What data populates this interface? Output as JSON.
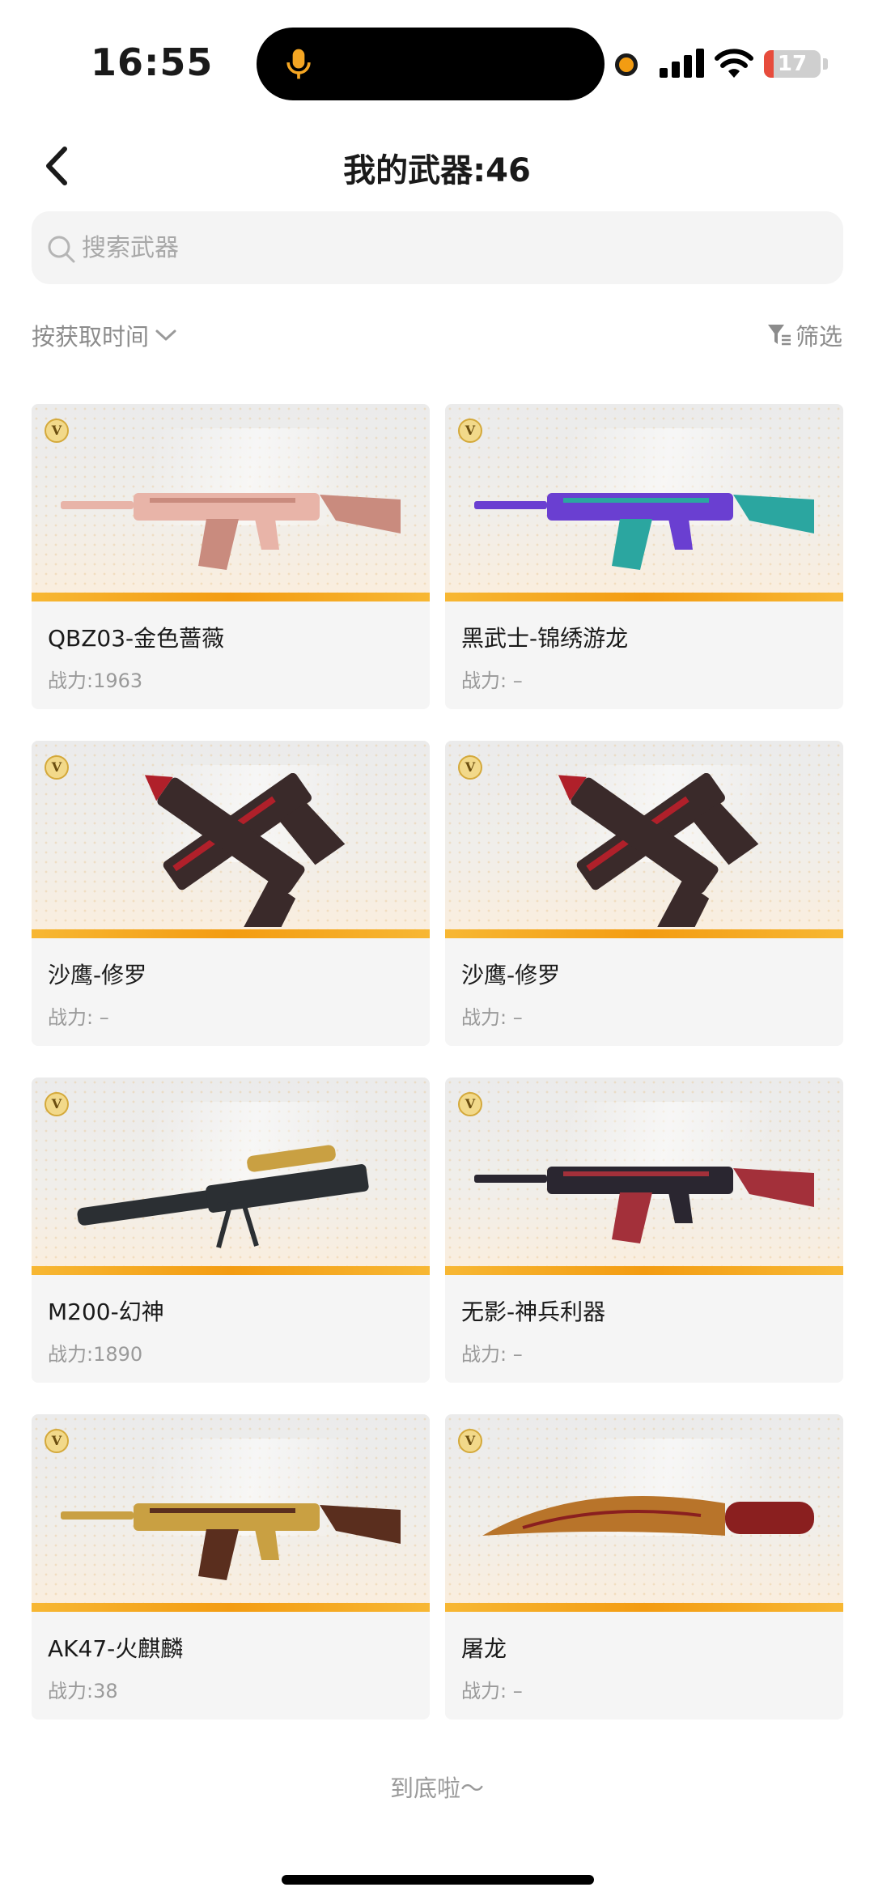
{
  "status_bar": {
    "time": "16:55",
    "battery_level": "17",
    "battery_color": "#e74c3c",
    "recording_dot_color": "#f39c12",
    "icons": [
      "microphone-icon",
      "signal-icon",
      "wifi-icon",
      "battery-icon"
    ]
  },
  "header": {
    "title": "我的武器:46",
    "back_icon": "chevron-left-icon"
  },
  "search": {
    "placeholder": "搜索武器",
    "value": "",
    "icon": "search-icon"
  },
  "toolbar": {
    "sort_label": "按获取时间",
    "sort_icon": "chevron-down-icon",
    "filter_label": "筛选",
    "filter_icon": "funnel-icon"
  },
  "weapons": [
    {
      "name": "QBZ03-金色蔷薇",
      "power": "战力:1963",
      "badge": "V",
      "icon": "rifle-icon",
      "colors": [
        "#e8b4a8",
        "#c98b7e"
      ]
    },
    {
      "name": "黑武士-锦绣游龙",
      "power": "战力: –",
      "badge": "V",
      "icon": "rifle-icon",
      "colors": [
        "#6a3fd1",
        "#2ba6a0"
      ]
    },
    {
      "name": "沙鹰-修罗",
      "power": "战力: –",
      "badge": "V",
      "icon": "pistol-icon",
      "colors": [
        "#3a2a2a",
        "#b0202a"
      ]
    },
    {
      "name": "沙鹰-修罗",
      "power": "战力: –",
      "badge": "V",
      "icon": "pistol-icon",
      "colors": [
        "#3a2a2a",
        "#b0202a"
      ]
    },
    {
      "name": "M200-幻神",
      "power": "战力:1890",
      "badge": "V",
      "icon": "sniper-rifle-icon",
      "colors": [
        "#2b2f33",
        "#c9a042"
      ]
    },
    {
      "name": "无影-神兵利器",
      "power": "战力: –",
      "badge": "V",
      "icon": "rifle-icon",
      "colors": [
        "#2a2630",
        "#a3303a"
      ]
    },
    {
      "name": "AK47-火麒麟",
      "power": "战力:38",
      "badge": "V",
      "icon": "rifle-icon",
      "colors": [
        "#c9a042",
        "#5a2e1e"
      ]
    },
    {
      "name": "屠龙",
      "power": "战力: –",
      "badge": "V",
      "icon": "knife-icon",
      "colors": [
        "#b8742a",
        "#8a1f1f"
      ]
    }
  ],
  "footer": {
    "end_text": "到底啦～"
  }
}
